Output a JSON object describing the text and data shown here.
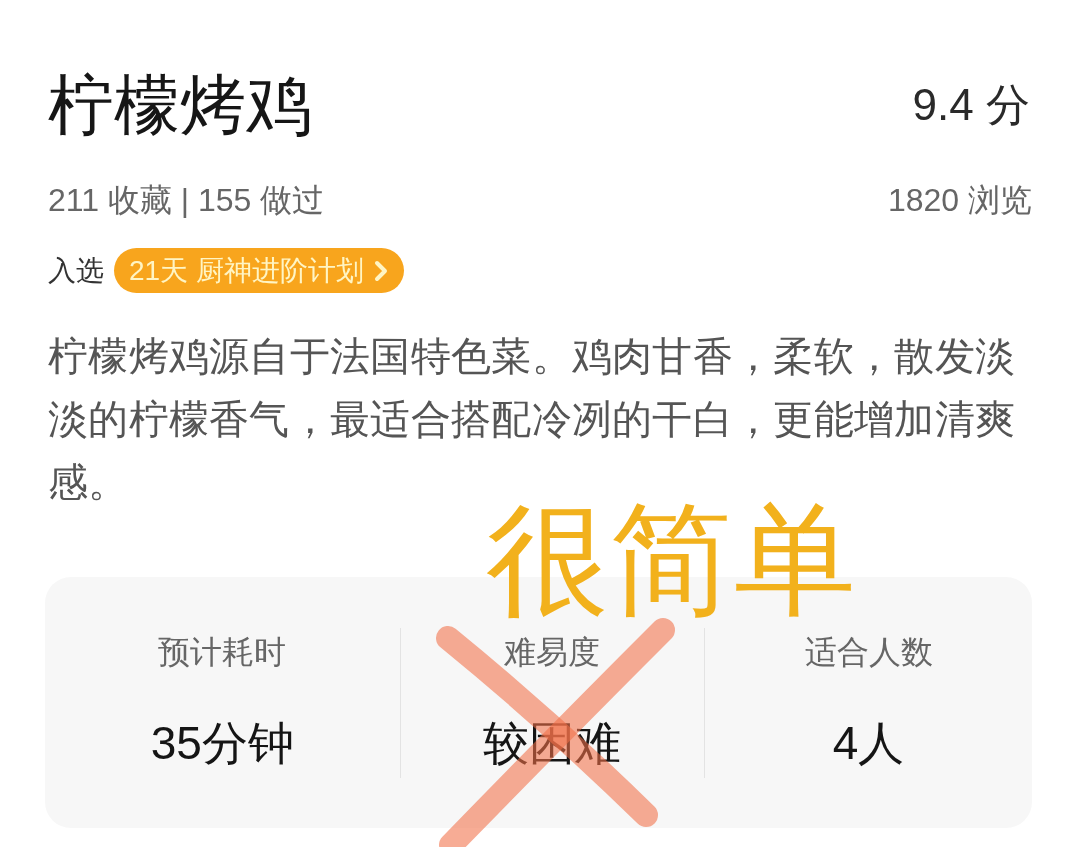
{
  "recipe": {
    "title": "柠檬烤鸡",
    "score": "9.4 分",
    "stats": "211 收藏 | 155 做过",
    "views": "1820 浏览"
  },
  "featured": {
    "label": "入选",
    "badge": "21天 厨神进阶计划"
  },
  "description": "柠檬烤鸡源自于法国特色菜。鸡肉甘香，柔软，散发淡淡的柠檬香气，最适合搭配冷冽的干白，更能增加清爽感。",
  "info_card": {
    "items": [
      {
        "label": "预计耗时",
        "value": "35分钟",
        "crossed_out": false
      },
      {
        "label": "难易度",
        "value": "较困难",
        "crossed_out": true
      },
      {
        "label": "适合人数",
        "value": "4人",
        "crossed_out": false
      }
    ]
  },
  "handwritten_note": "很简单"
}
